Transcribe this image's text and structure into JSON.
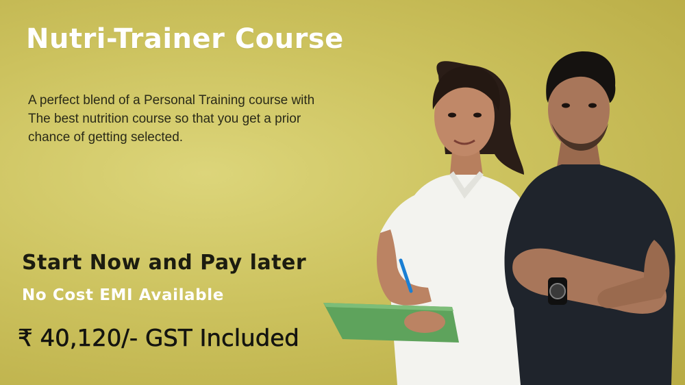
{
  "banner": {
    "title": "Nutri-Trainer Course",
    "description_lines": [
      "A perfect blend of a Personal Training course with",
      "The best nutrition course so that you get a prior",
      "chance of getting selected."
    ],
    "cta": "Start Now and Pay later",
    "emi": "No Cost EMI Available",
    "price": "₹ 40,120/- GST Included"
  },
  "colors": {
    "background": "#ccc25e",
    "title": "#ffffff",
    "emi_text": "#ffffff",
    "body_text": "#2a2a18"
  }
}
